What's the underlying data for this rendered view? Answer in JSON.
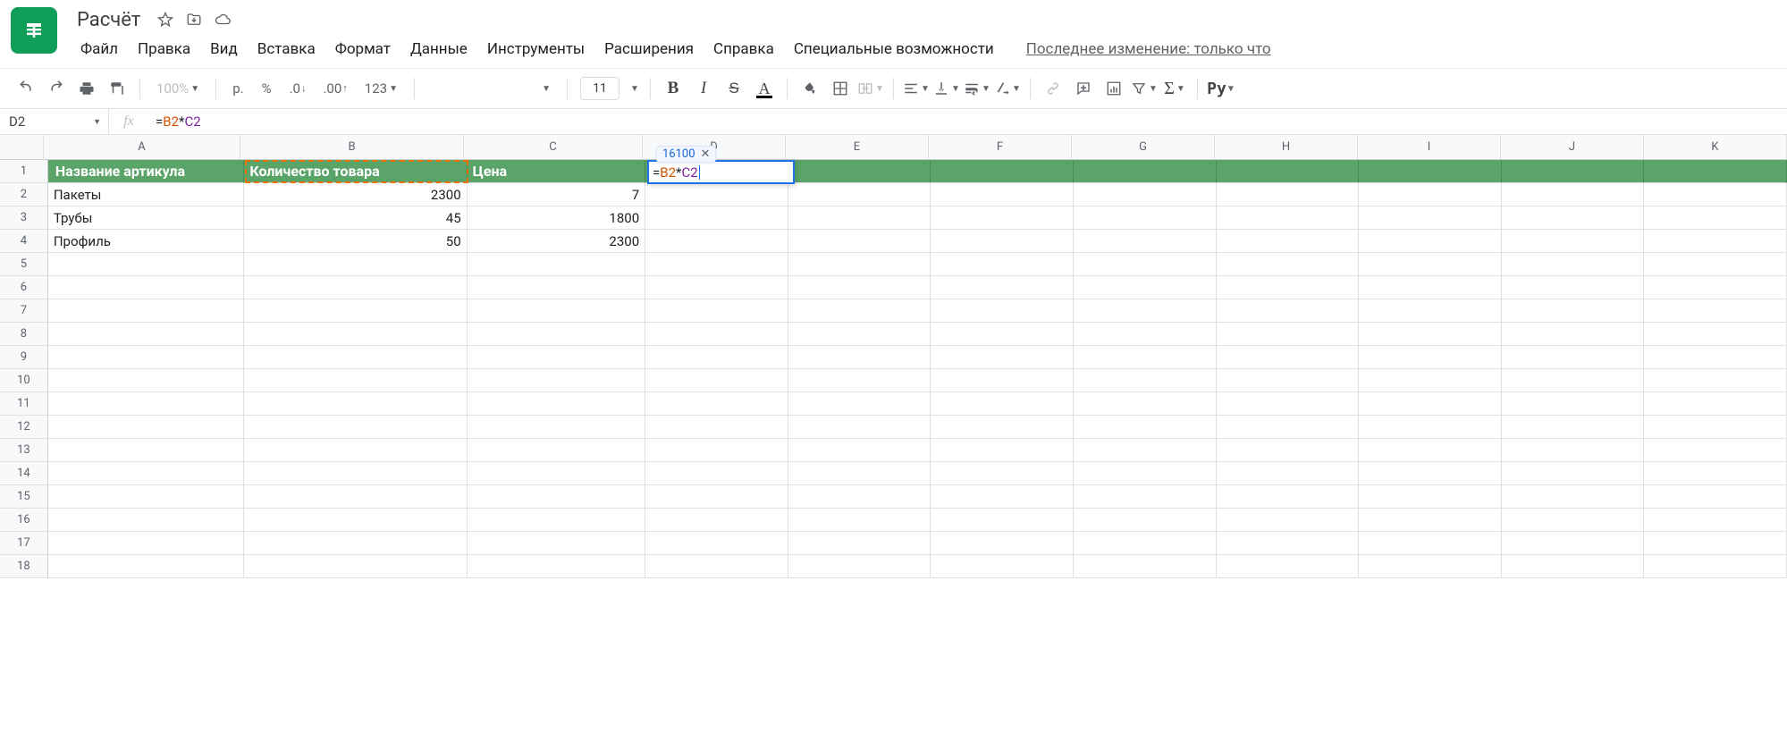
{
  "doc": {
    "title": "Расчёт"
  },
  "menus": [
    "Файл",
    "Правка",
    "Вид",
    "Вставка",
    "Формат",
    "Данные",
    "Инструменты",
    "Расширения",
    "Справка",
    "Специальные возможности"
  ],
  "last_edit": "Последнее изменение: только что",
  "toolbar": {
    "zoom": "100%",
    "currency": "р.",
    "percent": "%",
    "dec_dec": ".0",
    "dec_inc": ".00",
    "num_fmt": "123",
    "font_size": "11"
  },
  "namebox": "D2",
  "formula": {
    "eq": "=",
    "ref1": "B2",
    "op": "*",
    "ref2": "C2"
  },
  "columns": [
    "A",
    "B",
    "C",
    "D",
    "E",
    "F",
    "G",
    "H",
    "I",
    "J",
    "K"
  ],
  "col_classes": [
    "colA",
    "colB",
    "colC",
    "colD",
    "colE",
    "colF",
    "colG",
    "colH",
    "colI",
    "colJ",
    "colK"
  ],
  "headers": [
    "Название артикула",
    "Количество товара",
    "Цена"
  ],
  "rows": [
    {
      "a": "Пакеты",
      "b": "2300",
      "c": "7"
    },
    {
      "a": "Трубы",
      "b": "45",
      "c": "1800"
    },
    {
      "a": "Профиль",
      "b": "50",
      "c": "2300"
    }
  ],
  "preview_value": "16100",
  "empty_rows": 14
}
